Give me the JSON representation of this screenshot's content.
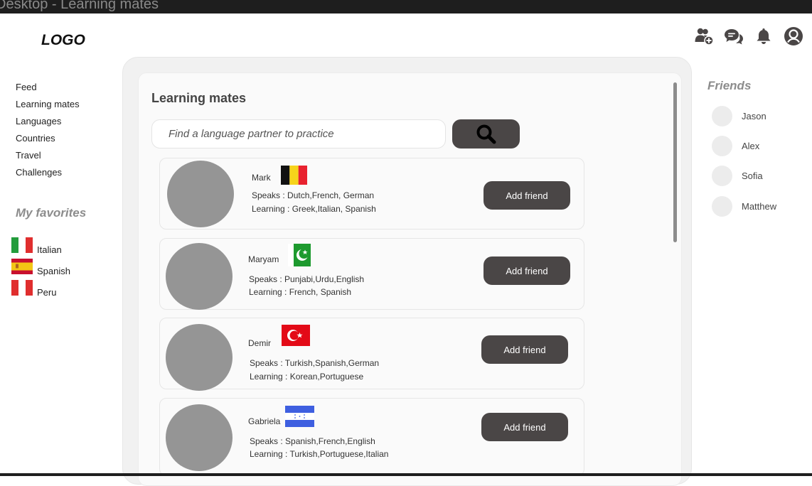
{
  "window": {
    "title": "Desktop - Learning mates"
  },
  "logo": "LOGO",
  "header_icons": [
    "add-friend-icon",
    "messages-icon",
    "notifications-bell-icon",
    "profile-avatar-icon"
  ],
  "nav": {
    "items": [
      {
        "label": "Feed"
      },
      {
        "label": "Learning mates"
      },
      {
        "label": "Languages"
      },
      {
        "label": "Countries"
      },
      {
        "label": "Travel"
      },
      {
        "label": "Challenges"
      }
    ]
  },
  "favorites": {
    "title": "My favorites",
    "items": [
      {
        "label": "Italian",
        "flag": "italy-flag-icon"
      },
      {
        "label": "Spanish",
        "flag": "spain-flag-icon"
      },
      {
        "label": "Peru",
        "flag": "peru-flag-icon"
      }
    ]
  },
  "main": {
    "title": "Learning mates",
    "search": {
      "placeholder": "Find a language partner to practice",
      "value": ""
    },
    "mates": [
      {
        "name": "Mark",
        "flag": "belgium-flag-icon",
        "speaks": "Speaks : Dutch,French, German",
        "learning": "Learning : Greek,Italian, Spanish",
        "button": "Add friend"
      },
      {
        "name": "Maryam",
        "flag": "pakistan-flag-icon",
        "speaks": "Speaks : Punjabi,Urdu,English",
        "learning": "Learning : French, Spanish",
        "button": "Add friend"
      },
      {
        "name": "Demir",
        "flag": "turkey-flag-icon",
        "speaks": "Speaks : Turkish,Spanish,German",
        "learning": "Learning : Korean,Portuguese",
        "button": "Add friend"
      },
      {
        "name": "Gabriela",
        "flag": "honduras-flag-icon",
        "speaks": "Speaks : Spanish,French,English",
        "learning": "Learning : Turkish,Portuguese,Italian",
        "button": "Add friend"
      }
    ]
  },
  "friends": {
    "title": "Friends",
    "items": [
      {
        "name": "Jason"
      },
      {
        "name": "Alex"
      },
      {
        "name": "Sofia"
      },
      {
        "name": "Matthew"
      }
    ]
  },
  "colors": {
    "button_bg": "#4a4646",
    "avatar_gray": "#959595",
    "panel_bg": "#f1f1f1",
    "muted_heading": "#8c8c8c"
  }
}
